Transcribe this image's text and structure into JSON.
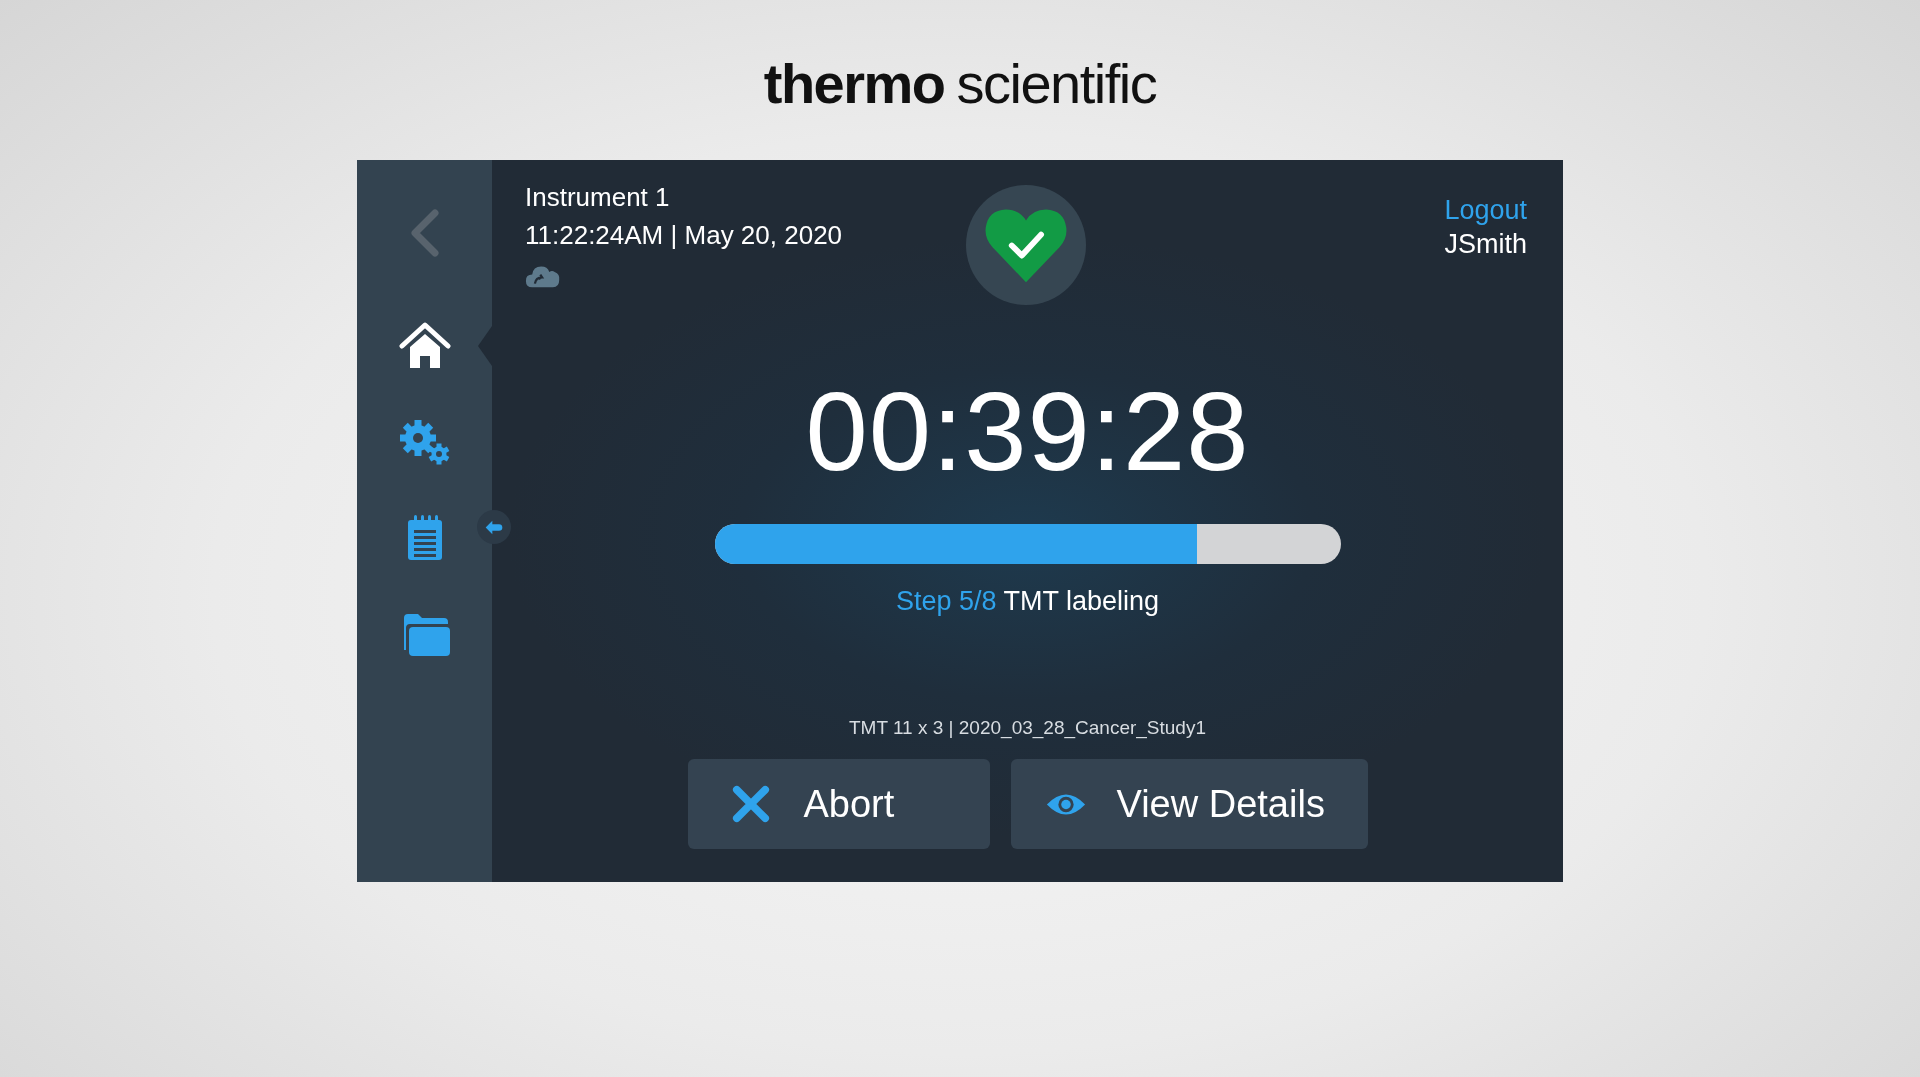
{
  "brand": {
    "bold": "thermo",
    "light": "scientific"
  },
  "sidebar": {
    "back": {
      "disabled": true
    },
    "items": [
      {
        "kind": "home",
        "selected": true
      },
      {
        "kind": "settings",
        "selected": false
      },
      {
        "kind": "notebook",
        "selected": false
      },
      {
        "kind": "folder",
        "selected": false
      }
    ],
    "collapse": {
      "kind": "arrow"
    }
  },
  "header": {
    "instrument": "Instrument 1",
    "time": "11:22:24AM",
    "separator": "|",
    "date": "May 20, 2020",
    "cloud": {
      "kind": "cloud"
    }
  },
  "status": {
    "kind": "ok"
  },
  "user": {
    "logout": "Logout",
    "name": "JSmith"
  },
  "run": {
    "timer": "00:39:28",
    "level": 0.77,
    "step": "Step 5/8",
    "step_name": "TMT labeling",
    "info": "TMT 11 x 3 | 2020_03_28_Cancer_Study1"
  },
  "buttons": [
    {
      "kind": "abort",
      "label": "Abort"
    },
    {
      "kind": "view",
      "label": "View Details"
    }
  ]
}
